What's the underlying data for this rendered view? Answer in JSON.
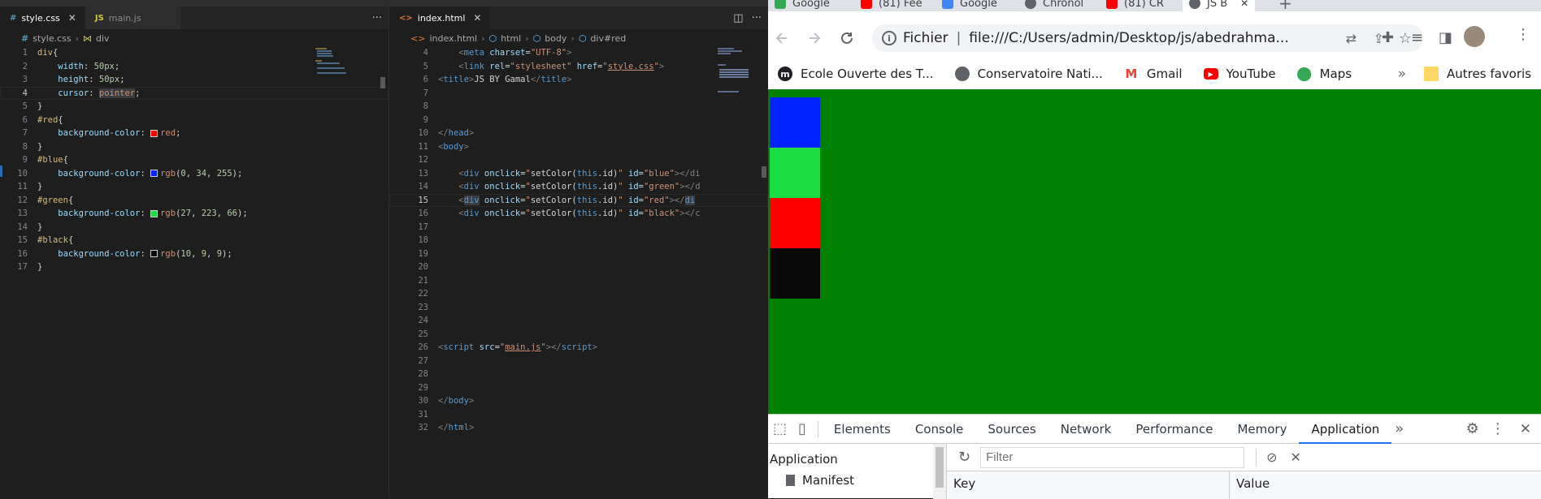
{
  "vscode_left": {
    "tabs": [
      {
        "icon": "#",
        "label": "style.css",
        "active": true
      },
      {
        "icon": "JS",
        "label": "main.js",
        "active": false
      }
    ],
    "more_label": "···",
    "breadcrumb": [
      "style.css",
      "div"
    ],
    "lines": [
      {
        "n": "1",
        "html": "<span class='sel'>div</span><span class='txt'>{</span>"
      },
      {
        "n": "2",
        "html": "    <span class='prop'>width</span><span class='txt'>: </span><span class='num'>50px</span><span class='txt'>;</span>"
      },
      {
        "n": "3",
        "html": "    <span class='prop'>height</span><span class='txt'>: </span><span class='num'>50px</span><span class='txt'>;</span>"
      },
      {
        "n": "4",
        "html": "    <span class='prop'>cursor</span><span class='txt'>: </span><span class='val' style='background:#3a3d41'>pointer</span><span class='txt'>;</span>",
        "current": true
      },
      {
        "n": "5",
        "html": "<span class='txt'>}</span>"
      },
      {
        "n": "6",
        "html": "<span class='sel'>#red</span><span class='txt'>{</span>"
      },
      {
        "n": "7",
        "html": "    <span class='prop'>background-color</span><span class='txt'>: </span><span class='sw' style='background:#ff0000'></span><span class='val'>red</span><span class='txt'>;</span>"
      },
      {
        "n": "8",
        "html": "<span class='txt'>}</span>"
      },
      {
        "n": "9",
        "html": "<span class='sel'>#blue</span><span class='txt'>{</span>"
      },
      {
        "n": "10",
        "html": "    <span class='prop'>background-color</span><span class='txt'>: </span><span class='sw' style='background:#0022ff'></span><span class='val'>rgb</span><span class='txt'>(</span><span class='num'>0</span><span class='txt'>, </span><span class='num'>34</span><span class='txt'>, </span><span class='num'>255</span><span class='txt'>);</span>"
      },
      {
        "n": "11",
        "html": "<span class='txt'>}</span>"
      },
      {
        "n": "12",
        "html": "<span class='sel'>#green</span><span class='txt'>{</span>"
      },
      {
        "n": "13",
        "html": "    <span class='prop'>background-color</span><span class='txt'>: </span><span class='sw' style='background:#1bdf42'></span><span class='val'>rgb</span><span class='txt'>(</span><span class='num'>27</span><span class='txt'>, </span><span class='num'>223</span><span class='txt'>, </span><span class='num'>66</span><span class='txt'>);</span>"
      },
      {
        "n": "14",
        "html": "<span class='txt'>}</span>"
      },
      {
        "n": "15",
        "html": "<span class='sel'>#black</span><span class='txt'>{</span>"
      },
      {
        "n": "16",
        "html": "    <span class='prop'>background-color</span><span class='txt'>: </span><span class='sw' style='background:#0a0909'></span><span class='val'>rgb</span><span class='txt'>(</span><span class='num'>10</span><span class='txt'>, </span><span class='num'>9</span><span class='txt'>, </span><span class='num'>9</span><span class='txt'>);</span>"
      },
      {
        "n": "17",
        "html": "<span class='txt'>}</span>"
      }
    ]
  },
  "vscode_right": {
    "tab": {
      "icon": "<>",
      "label": "index.html"
    },
    "breadcrumb": [
      "index.html",
      "html",
      "body",
      "div#red"
    ],
    "lines": [
      {
        "n": "4",
        "html": "    <span class='tagc'>&lt;</span><span class='tagn'>meta</span> <span class='attr'>charset</span><span class='txt'>=</span><span class='str'>\"UTF-8\"</span><span class='tagc'>&gt;</span>"
      },
      {
        "n": "5",
        "html": "    <span class='tagc'>&lt;</span><span class='tagn'>link</span> <span class='attr'>rel</span><span class='txt'>=</span><span class='str'>\"stylesheet\"</span> <span class='attr'>href</span><span class='txt'>=</span><span class='str'>\"<u>style.css</u>\"</span><span class='tagc'>&gt;</span>"
      },
      {
        "n": "6",
        "html": "<span class='tagc'>&lt;</span><span class='tagn'>title</span><span class='tagc'>&gt;</span><span class='txt'>JS BY Gamal</span><span class='tagc'>&lt;/</span><span class='tagn'>title</span><span class='tagc'>&gt;</span>"
      },
      {
        "n": "7",
        "html": ""
      },
      {
        "n": "8",
        "html": ""
      },
      {
        "n": "9",
        "html": ""
      },
      {
        "n": "10",
        "html": "<span class='tagc'>&lt;/</span><span class='tagn'>head</span><span class='tagc'>&gt;</span>"
      },
      {
        "n": "11",
        "html": "<span class='tagc'>&lt;</span><span class='tagn'>body</span><span class='tagc'>&gt;</span>"
      },
      {
        "n": "12",
        "html": ""
      },
      {
        "n": "13",
        "html": "    <span class='tagc'>&lt;</span><span class='tagn'>div</span> <span class='attr'>onclick</span><span class='txt'>=</span><span class='str'>\"</span><span class='txt'>setColor(</span><span class='kw'>this</span><span class='txt'>.id)</span><span class='str'>\"</span> <span class='attr'>id</span><span class='txt'>=</span><span class='str'>\"blue\"</span><span class='tagc'>&gt;&lt;/di</span>"
      },
      {
        "n": "14",
        "html": "    <span class='tagc'>&lt;</span><span class='tagn'>div</span> <span class='attr'>onclick</span><span class='txt'>=</span><span class='str'>\"</span><span class='txt'>setColor(</span><span class='kw'>this</span><span class='txt'>.id)</span><span class='str'>\"</span> <span class='attr'>id</span><span class='txt'>=</span><span class='str'>\"green\"</span><span class='tagc'>&gt;&lt;/d</span>"
      },
      {
        "n": "15",
        "html": "    <span class='tagc'>&lt;</span><span class='tagn' style='background:#3a3d41'>div</span> <span class='attr'>onclick</span><span class='txt'>=</span><span class='str'>\"</span><span class='txt'>setColor(</span><span class='kw'>this</span><span class='txt'>.id)</span><span class='str'>\"</span> <span class='attr'>id</span><span class='txt'>=</span><span class='str'>\"red\"</span><span class='tagc'>&gt;&lt;/</span><span class='tagn' style='background:#3a3d41'>di</span>",
        "current": true
      },
      {
        "n": "16",
        "html": "    <span class='tagc'>&lt;</span><span class='tagn'>div</span> <span class='attr'>onclick</span><span class='txt'>=</span><span class='str'>\"</span><span class='txt'>setColor(</span><span class='kw'>this</span><span class='txt'>.id)</span><span class='str'>\"</span> <span class='attr'>id</span><span class='txt'>=</span><span class='str'>\"black\"</span><span class='tagc'>&gt;&lt;/c</span>"
      },
      {
        "n": "17",
        "html": ""
      },
      {
        "n": "18",
        "html": ""
      },
      {
        "n": "19",
        "html": ""
      },
      {
        "n": "20",
        "html": ""
      },
      {
        "n": "21",
        "html": ""
      },
      {
        "n": "22",
        "html": ""
      },
      {
        "n": "23",
        "html": ""
      },
      {
        "n": "24",
        "html": ""
      },
      {
        "n": "25",
        "html": ""
      },
      {
        "n": "26",
        "html": "<span class='tagc'>&lt;</span><span class='tagn'>script</span> <span class='attr'>src</span><span class='txt'>=</span><span class='str'>\"<u>main.js</u>\"</span><span class='tagc'>&gt;&lt;/</span><span class='tagn'>script</span><span class='tagc'>&gt;</span>"
      },
      {
        "n": "27",
        "html": ""
      },
      {
        "n": "28",
        "html": ""
      },
      {
        "n": "29",
        "html": ""
      },
      {
        "n": "30",
        "html": "<span class='tagc'>&lt;/</span><span class='tagn'>body</span><span class='tagc'>&gt;</span>"
      },
      {
        "n": "31",
        "html": ""
      },
      {
        "n": "32",
        "html": "<span class='tagc'>&lt;/</span><span class='tagn'>html</span><span class='tagc'>&gt;</span>"
      }
    ]
  },
  "chrome": {
    "tabs": [
      {
        "label": "Google",
        "color": "#34a853"
      },
      {
        "label": "(81) Fee",
        "color": "#ff0000"
      },
      {
        "label": "Google",
        "color": "#4285f4"
      },
      {
        "label": "Chronol",
        "color": "#5f6368"
      },
      {
        "label": "(81) CR",
        "color": "#ff0000"
      },
      {
        "label": "JS B",
        "color": "#5f6368"
      }
    ],
    "new_tab": "+",
    "omnibox": {
      "scheme": "Fichier",
      "url": "file:///C:/Users/admin/Desktop/js/abedrahma..."
    },
    "bookmarks": [
      {
        "label": "Ecole Ouverte des T...",
        "icon": "m-icon"
      },
      {
        "label": "Conservatoire Nati...",
        "icon": "globe-icon"
      },
      {
        "label": "Gmail",
        "icon": "gmail-icon"
      },
      {
        "label": "YouTube",
        "icon": "youtube-icon"
      },
      {
        "label": "Maps",
        "icon": "maps-icon"
      }
    ],
    "more_bookmarks": "»",
    "other_bookmarks": "Autres favoris",
    "page": {
      "background": "#008000",
      "boxes": [
        {
          "id": "blue",
          "color": "#0022ff"
        },
        {
          "id": "green",
          "color": "#1bdf42"
        },
        {
          "id": "red",
          "color": "#ff0000"
        },
        {
          "id": "black",
          "color": "#0a0909"
        }
      ]
    },
    "devtools": {
      "tabs": [
        "Elements",
        "Console",
        "Sources",
        "Network",
        "Performance",
        "Memory",
        "Application"
      ],
      "active_tab": "Application",
      "overflow": "»",
      "sidebar_title": "Application",
      "sidebar_item": "Manifest",
      "filter_placeholder": "Filter",
      "columns": [
        "Key",
        "Value"
      ]
    }
  }
}
